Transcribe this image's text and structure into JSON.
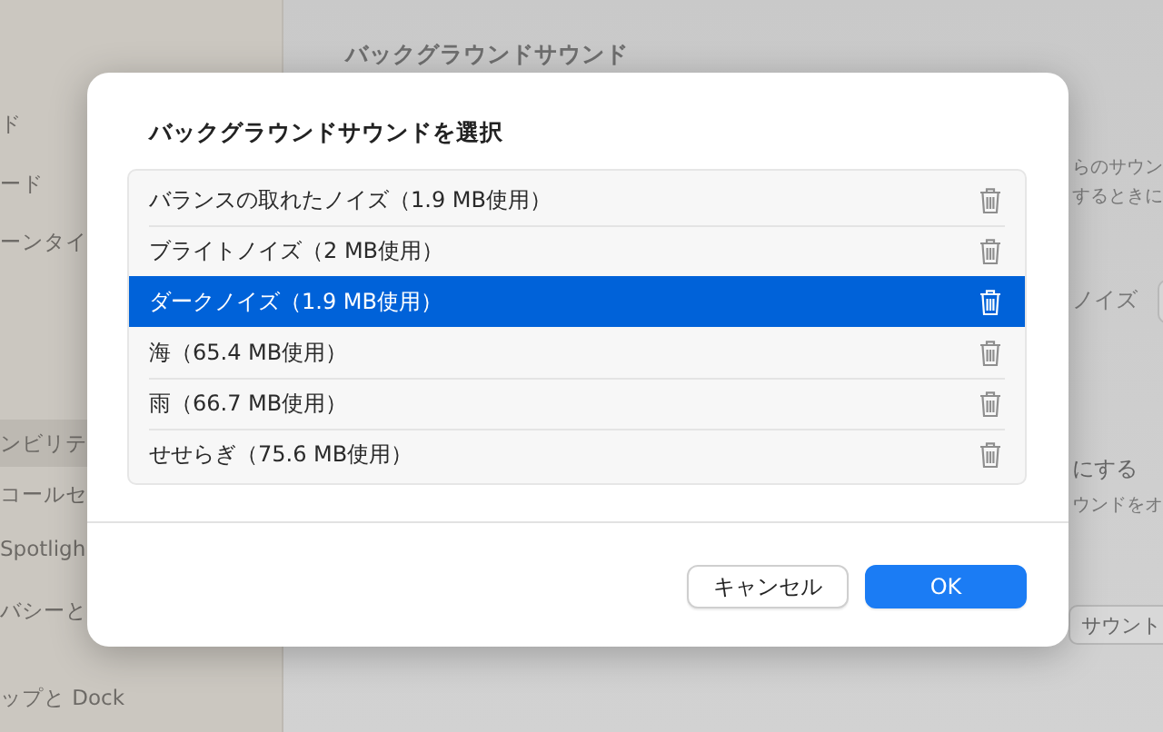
{
  "sidebar": {
    "items": [
      {
        "label": "ド",
        "selected": false
      },
      {
        "label": "ード",
        "selected": false
      },
      {
        "label": "ーンタイ",
        "selected": false
      },
      {
        "label": "ンビリテ",
        "selected": true
      },
      {
        "label": "コールセ",
        "selected": false
      },
      {
        "label": "Spotligh",
        "selected": false
      },
      {
        "label": "バシーと",
        "selected": false
      },
      {
        "label": "ップと Dock",
        "selected": false
      }
    ]
  },
  "settings": {
    "heading": "バックグラウンドサウンド",
    "texts": [
      "らのサウン",
      "するときに",
      "ノイズ",
      "にする",
      "ウンドをオ"
    ],
    "button": "サウント"
  },
  "dialog": {
    "title": "バックグラウンドサウンドを選択",
    "sounds": [
      {
        "label": "バランスの取れたノイズ（1.9 MB使用）",
        "selected": false
      },
      {
        "label": "ブライトノイズ（2 MB使用）",
        "selected": false
      },
      {
        "label": "ダークノイズ（1.9 MB使用）",
        "selected": true
      },
      {
        "label": "海（65.4 MB使用）",
        "selected": false
      },
      {
        "label": "雨（66.7 MB使用）",
        "selected": false
      },
      {
        "label": "せせらぎ（75.6 MB使用）",
        "selected": false
      }
    ],
    "buttons": [
      {
        "label": "キャンセル",
        "kind": "secondary"
      },
      {
        "label": "OK",
        "kind": "primary"
      }
    ]
  }
}
